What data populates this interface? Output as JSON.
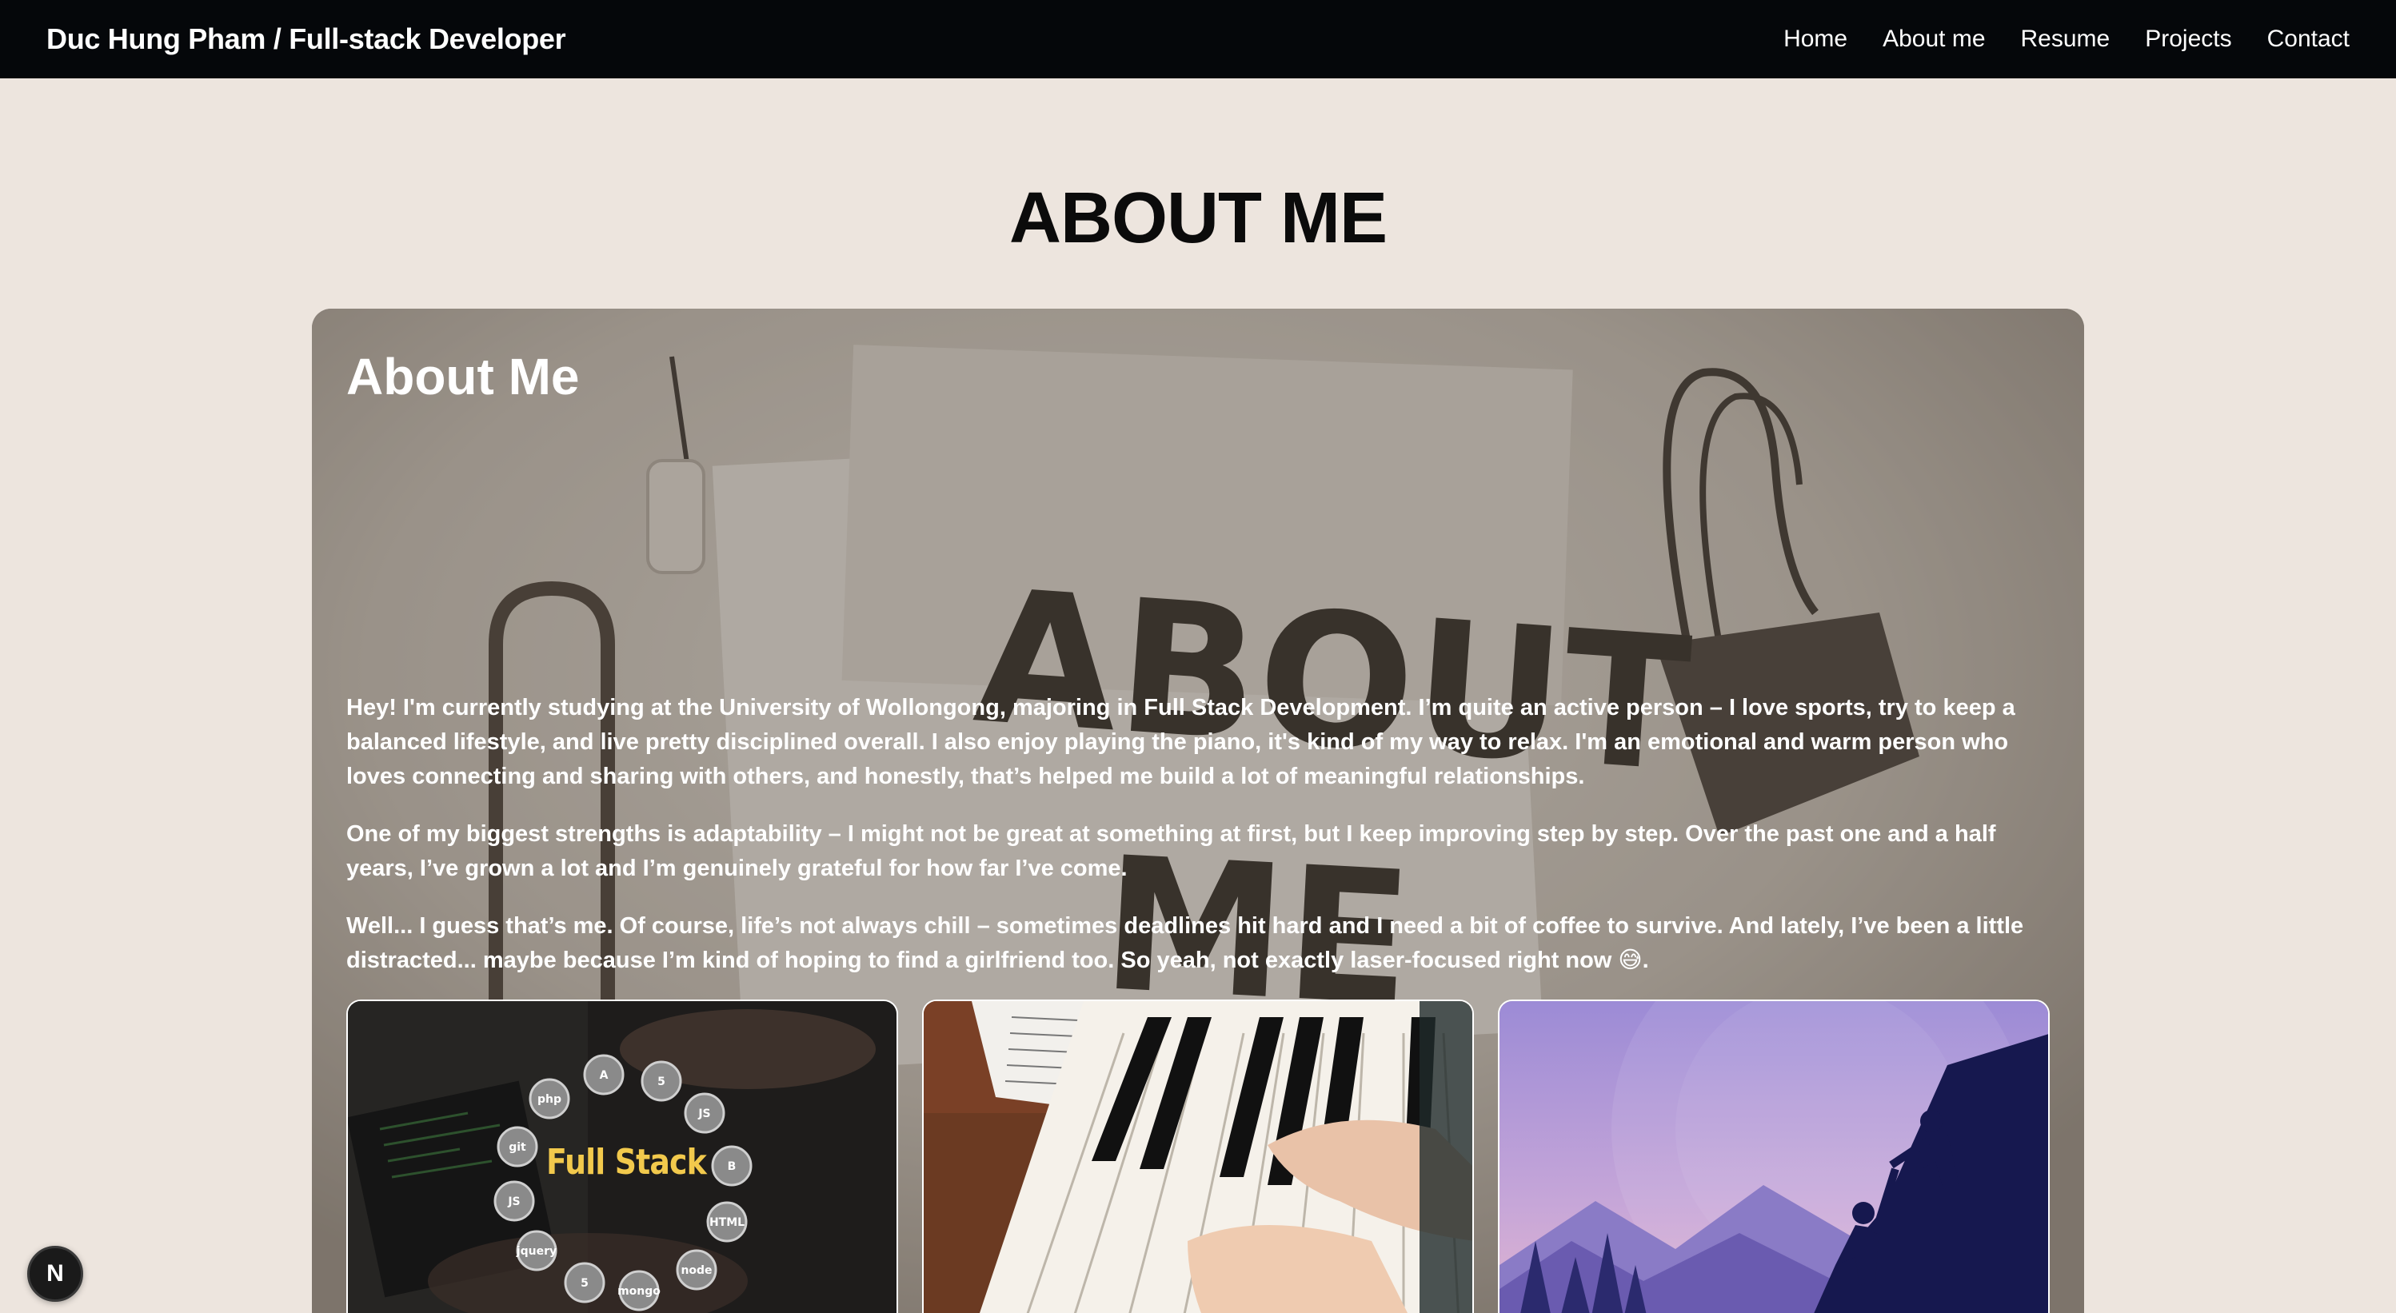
{
  "nav": {
    "brand": "Duc Hung Pham / Full-stack Developer",
    "links": [
      {
        "label": "Home"
      },
      {
        "label": "About me"
      },
      {
        "label": "Resume"
      },
      {
        "label": "Projects"
      },
      {
        "label": "Contact"
      }
    ]
  },
  "page": {
    "heading": "ABOUT ME"
  },
  "about_card": {
    "title": "About Me",
    "background_text": [
      "ABOUT",
      "ME"
    ],
    "paragraphs": [
      "Hey! I'm currently studying at the University of Wollongong, majoring in Full Stack Development. I’m quite an active person – I love sports, try to keep a balanced lifestyle, and live pretty disciplined overall. I also enjoy playing the piano, it's kind of my way to relax. I'm an emotional and warm person who loves connecting and sharing with others, and honestly, that’s helped me build a lot of meaningful relationships.",
      "One of my biggest strengths is adaptability – I might not be great at something at first, but I keep improving step by step. Over the past one and a half years, I’ve grown a lot and I’m genuinely grateful for how far I’ve come.",
      "Well... I guess that’s me. Of course, life’s not always chill – sometimes deadlines hit hard and I need a bit of coffee to survive. And lately, I’ve been a little distracted... maybe because I’m kind of hoping to find a girlfriend too. So yeah, not exactly laser-focused right now 😅."
    ]
  },
  "tiles": [
    {
      "name": "full-stack",
      "label": "Full Stack",
      "icons": [
        "A",
        "5",
        "JS",
        "B",
        "HTML",
        "php",
        "git",
        "JS",
        "jquery",
        "5",
        "mongo",
        "node"
      ]
    },
    {
      "name": "piano"
    },
    {
      "name": "climbing"
    }
  ],
  "badge": {
    "label": "N"
  },
  "colors": {
    "nav_bg": "#05070a",
    "page_bg": "#ede5de",
    "text_dark": "#0b0b0b",
    "accent_yellow": "#f2c94c"
  }
}
